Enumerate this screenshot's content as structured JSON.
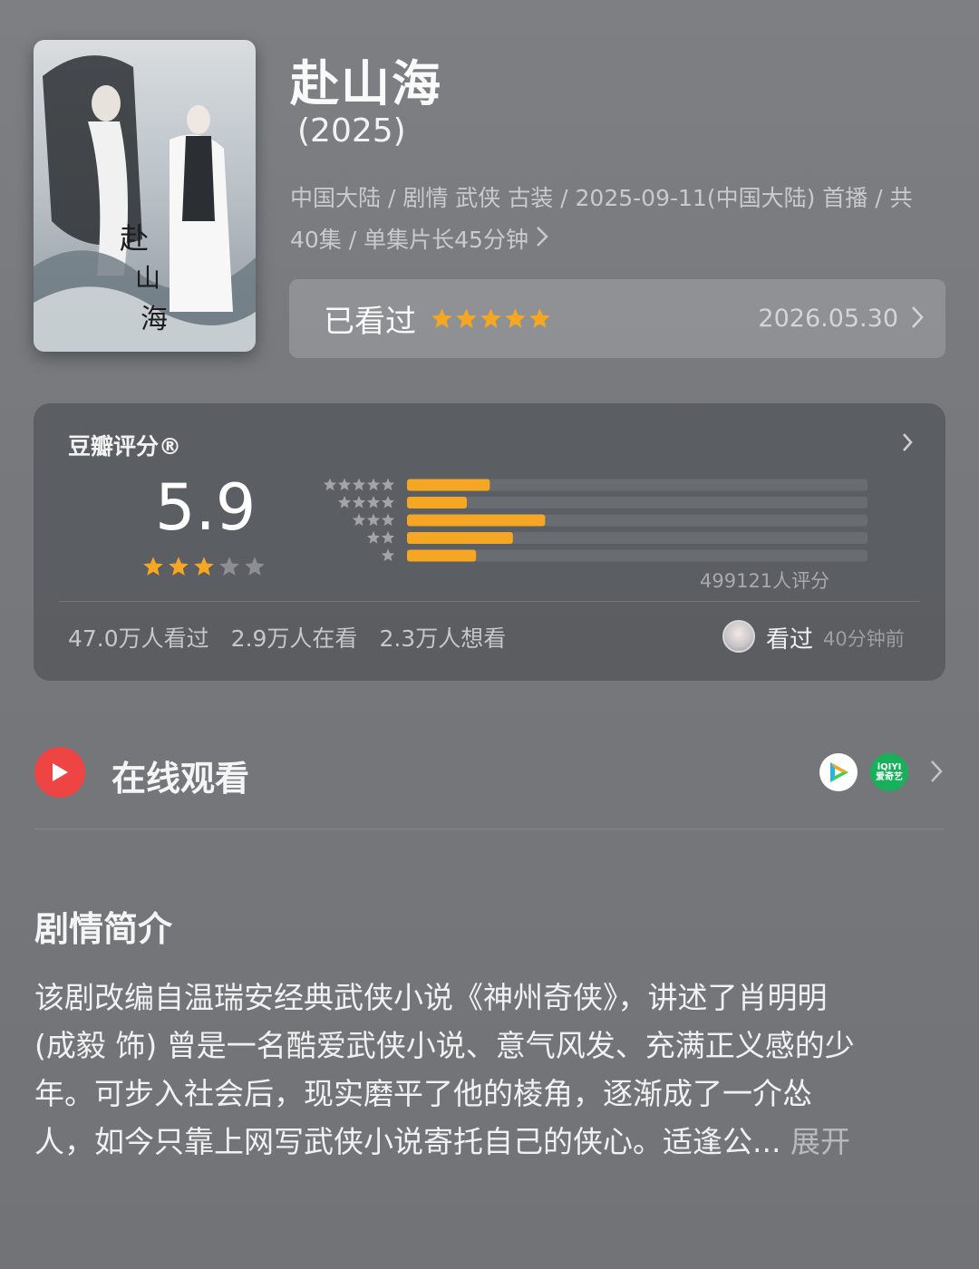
{
  "show": {
    "title": "赴山海",
    "year": "(2025)",
    "meta_line1": "中国大陆 / 剧情 武侠 古装 / 2025-09-11(中国大陆) 首播 / 共",
    "meta_line2": "40集 / 单集片长45分钟",
    "poster_icon": "poster-image"
  },
  "watched": {
    "label": "已看过",
    "stars": 5,
    "date": "2026.05.30"
  },
  "rating": {
    "title": "豆瓣评分®",
    "score": "5.9",
    "score_stars": 3,
    "count": "499121人评分",
    "distribution": [
      {
        "stars": 5,
        "fraction": 0.18
      },
      {
        "stars": 4,
        "fraction": 0.13
      },
      {
        "stars": 3,
        "fraction": 0.3
      },
      {
        "stars": 2,
        "fraction": 0.23
      },
      {
        "stars": 1,
        "fraction": 0.15
      }
    ],
    "stats": [
      "47.0万人看过",
      "2.9万人在看",
      "2.3万人想看"
    ],
    "seen_label": "看过",
    "seen_time": "40分钟前"
  },
  "online": {
    "label": "在线观看",
    "providers": [
      "tencent-video-icon",
      "iqiyi-icon"
    ],
    "iqiyi_text_1": "iQIYI",
    "iqiyi_text_2": "爱奇艺"
  },
  "synopsis": {
    "title": "剧情简介",
    "line1": "该剧改编自温瑞安经典武侠小说《神州奇侠》，讲述了肖明明",
    "line2": "(成毅 饰) 曾是一名酷爱武侠小说、意气风发、充满正义感的少",
    "line3": "年。可步入社会后，现实磨平了他的棱角，逐渐成了一介怂",
    "line4": "人，如今只靠上网写武侠小说寄托自己的侠心。适逢公...",
    "expand": "展开"
  },
  "colors": {
    "accent_orange": "#f5a623",
    "play_red": "#ee4444",
    "iqiyi_green": "#18b05a"
  }
}
